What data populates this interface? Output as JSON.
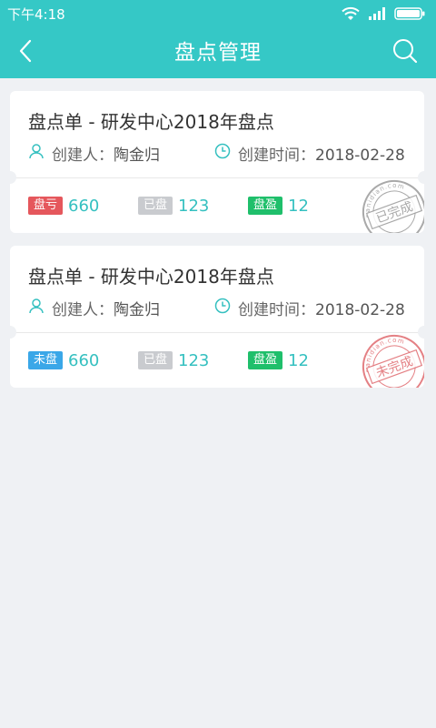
{
  "status_bar": {
    "time": "下午4:18"
  },
  "nav": {
    "title": "盘点管理"
  },
  "cards": [
    {
      "title": "盘点单 - 研发中心2018年盘点",
      "creator_label": "创建人：",
      "creator": "陶金归",
      "time_label": "创建时间：",
      "created_at": "2018-02-28",
      "stats": [
        {
          "label": "盘亏",
          "value": "660",
          "color": "#e5575c"
        },
        {
          "label": "已盘",
          "value": "123",
          "color": "#c9cbcf"
        },
        {
          "label": "盘盈",
          "value": "12",
          "color": "#1fbf6b"
        }
      ],
      "stamp": {
        "text": "已完成",
        "ring_text": "panidian.com",
        "color": "#9a9a9a"
      }
    },
    {
      "title": "盘点单 - 研发中心2018年盘点",
      "creator_label": "创建人：",
      "creator": "陶金归",
      "time_label": "创建时间：",
      "created_at": "2018-02-28",
      "stats": [
        {
          "label": "未盘",
          "value": "660",
          "color": "#3aa7e8"
        },
        {
          "label": "已盘",
          "value": "123",
          "color": "#c9cbcf"
        },
        {
          "label": "盘盈",
          "value": "12",
          "color": "#1fbf6b"
        }
      ],
      "stamp": {
        "text": "未完成",
        "ring_text": "panidian.com",
        "color": "#e06a6f"
      }
    }
  ],
  "colors": {
    "primary": "#35c8c6",
    "accent_text": "#35c0c0",
    "background": "#eff1f4"
  }
}
